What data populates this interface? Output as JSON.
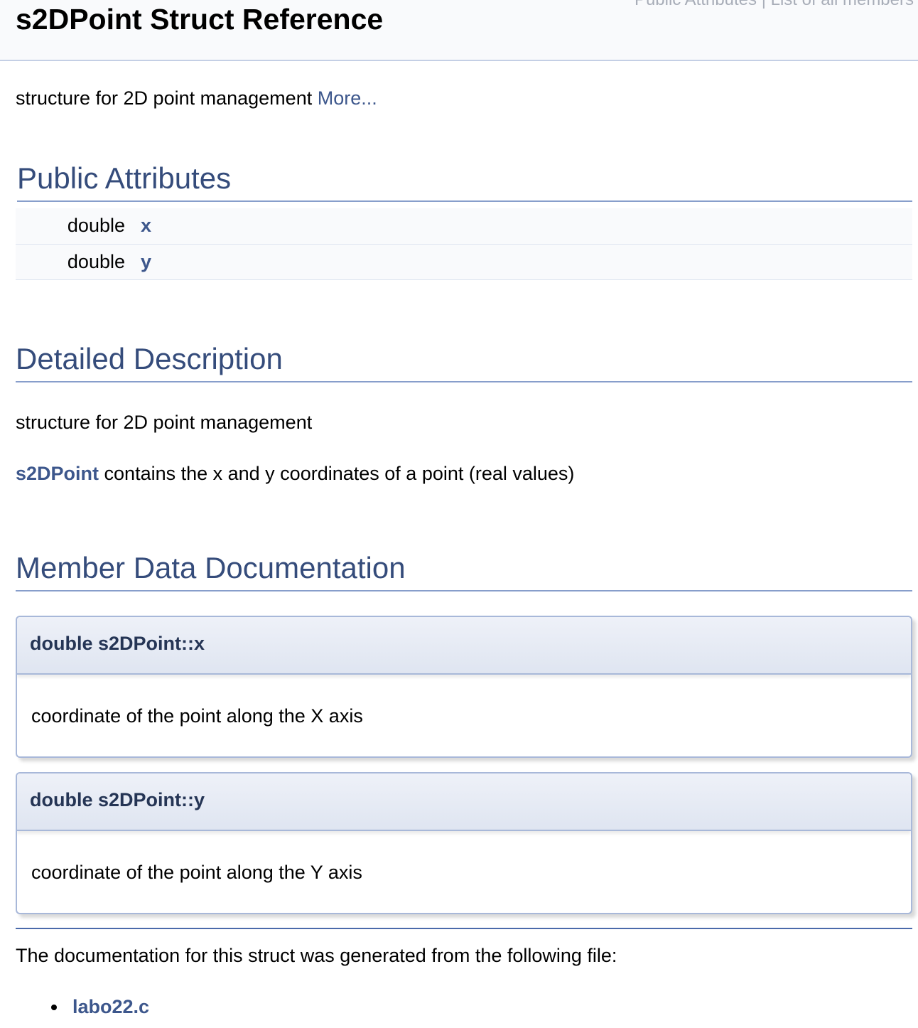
{
  "header": {
    "title": "s2DPoint Struct Reference",
    "links": "Public Attributes | List of all members"
  },
  "brief": {
    "text": "structure for 2D point management ",
    "more_link": "More..."
  },
  "public_attributes": {
    "heading": "Public Attributes",
    "rows": [
      {
        "type": "double",
        "name": "x"
      },
      {
        "type": "double",
        "name": "y"
      }
    ]
  },
  "detailed_description": {
    "heading": "Detailed Description",
    "paragraph1": "structure for 2D point management",
    "struct_link": "s2DPoint",
    "paragraph2_rest": " contains the x and y coordinates of a point (real values)"
  },
  "member_data": {
    "heading": "Member Data Documentation",
    "items": [
      {
        "proto": "double s2DPoint::x",
        "doc": "coordinate of the point along the X axis"
      },
      {
        "proto": "double s2DPoint::y",
        "doc": "coordinate of the point along the Y axis"
      }
    ]
  },
  "footer": {
    "text": "The documentation for this struct was generated from the following file:",
    "files": [
      "labo22.c"
    ]
  },
  "colors": {
    "link": "#3d578c",
    "heading": "#354c7b",
    "rule": "#879ecb"
  }
}
